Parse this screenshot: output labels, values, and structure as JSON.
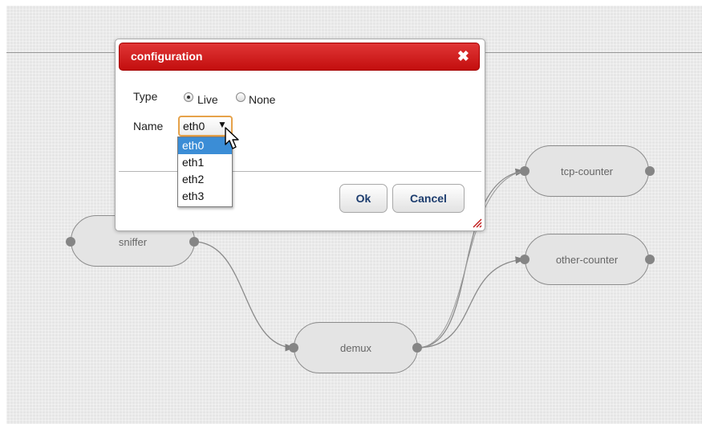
{
  "graph": {
    "nodes": [
      {
        "id": "sniffer",
        "label": "sniffer"
      },
      {
        "id": "demux",
        "label": "demux"
      },
      {
        "id": "tcp-counter",
        "label": "tcp-counter"
      },
      {
        "id": "other-counter",
        "label": "other-counter"
      }
    ],
    "edges": [
      {
        "from": "sniffer",
        "to": "demux"
      },
      {
        "from": "demux",
        "to": "tcp-counter"
      },
      {
        "from": "demux",
        "to": "other-counter"
      }
    ]
  },
  "dialog": {
    "title": "configuration",
    "close_icon": "close-icon",
    "type_label": "Type",
    "type_options": [
      "Live",
      "None"
    ],
    "type_selected": "Live",
    "name_label": "Name",
    "name_value": "eth0",
    "name_options": [
      "eth0",
      "eth1",
      "eth2",
      "eth3"
    ],
    "name_highlighted": "eth0",
    "ok_label": "Ok",
    "cancel_label": "Cancel"
  },
  "colors": {
    "titlebar": "#d11f1f",
    "dropdown_highlight": "#3b8dd6",
    "select_focus_border": "#e6a24a",
    "button_text": "#1c3c6e",
    "canvas": "#e6e6e6",
    "node_border": "#8c8c8c"
  }
}
